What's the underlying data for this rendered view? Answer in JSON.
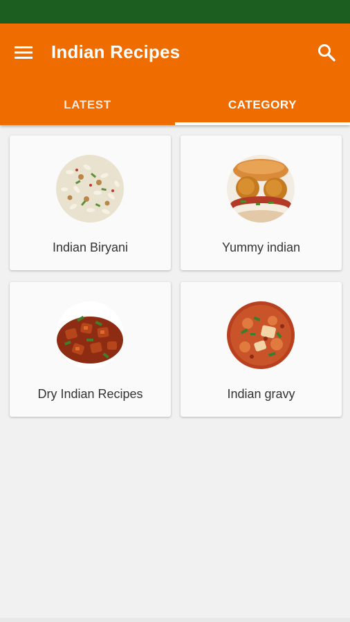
{
  "app": {
    "title": "Indian Recipes",
    "menu_icon": "hamburger-menu-icon",
    "search_icon": "search-icon"
  },
  "tabs": [
    {
      "label": "LATEST",
      "selected": false
    },
    {
      "label": "CATEGORY",
      "selected": true
    }
  ],
  "categories": [
    {
      "label": "Indian Biryani",
      "image": "biryani-rice-image"
    },
    {
      "label": "Yummy indian",
      "image": "vada-pav-image"
    },
    {
      "label": "Dry Indian Recipes",
      "image": "chilli-paneer-dry-image"
    },
    {
      "label": "Indian gravy",
      "image": "paneer-gravy-image"
    }
  ],
  "colors": {
    "status_bar": "#1b5e20",
    "primary": "#ef6c00",
    "background": "#f1f1f1",
    "card": "#fafafa"
  }
}
